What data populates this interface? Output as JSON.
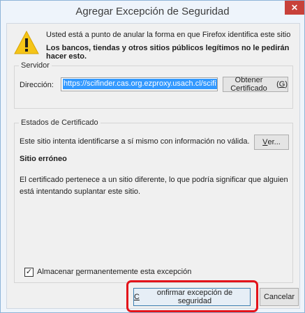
{
  "window": {
    "title": "Agregar Excepción de Seguridad",
    "close_glyph": "✕"
  },
  "warning": {
    "icon": "warning-icon",
    "line1": "Usted está a punto de anular la forma en que Firefox identifica este sitio",
    "line2": "Los bancos, tiendas y otros sitios públicos legítimos no le pedirán hacer esto."
  },
  "server": {
    "legend": "Servidor",
    "address_label": "Dirección:",
    "address_value": "https://scifinder.cas.org.ezproxy.usach.cl/scifi",
    "get_certificate_label": "Obtener Certificado",
    "get_certificate_accel": "G"
  },
  "certificate": {
    "legend": "Estados de Certificado",
    "status_text": "Este sitio intenta identificarse a sí mismo con información no válida.",
    "view_label": "Ver...",
    "view_accel": "V",
    "problem_title": "Sitio erróneo",
    "problem_description": "El certificado pertenece a un sitio diferente, lo que podría significar que alguien está intentando suplantar este sitio."
  },
  "permanent": {
    "checked": true,
    "check_glyph": "✓",
    "label_prefix": "Almacenar ",
    "label_accel": "p",
    "label_suffix": "ermanentemente esta excepción"
  },
  "buttons": {
    "confirm_accel": "C",
    "confirm_rest": "onfirmar excepción de seguridad",
    "cancel_label": "Cancelar"
  },
  "colors": {
    "highlight": "#e3131a",
    "selection": "#3399ff",
    "close": "#c8413a"
  }
}
